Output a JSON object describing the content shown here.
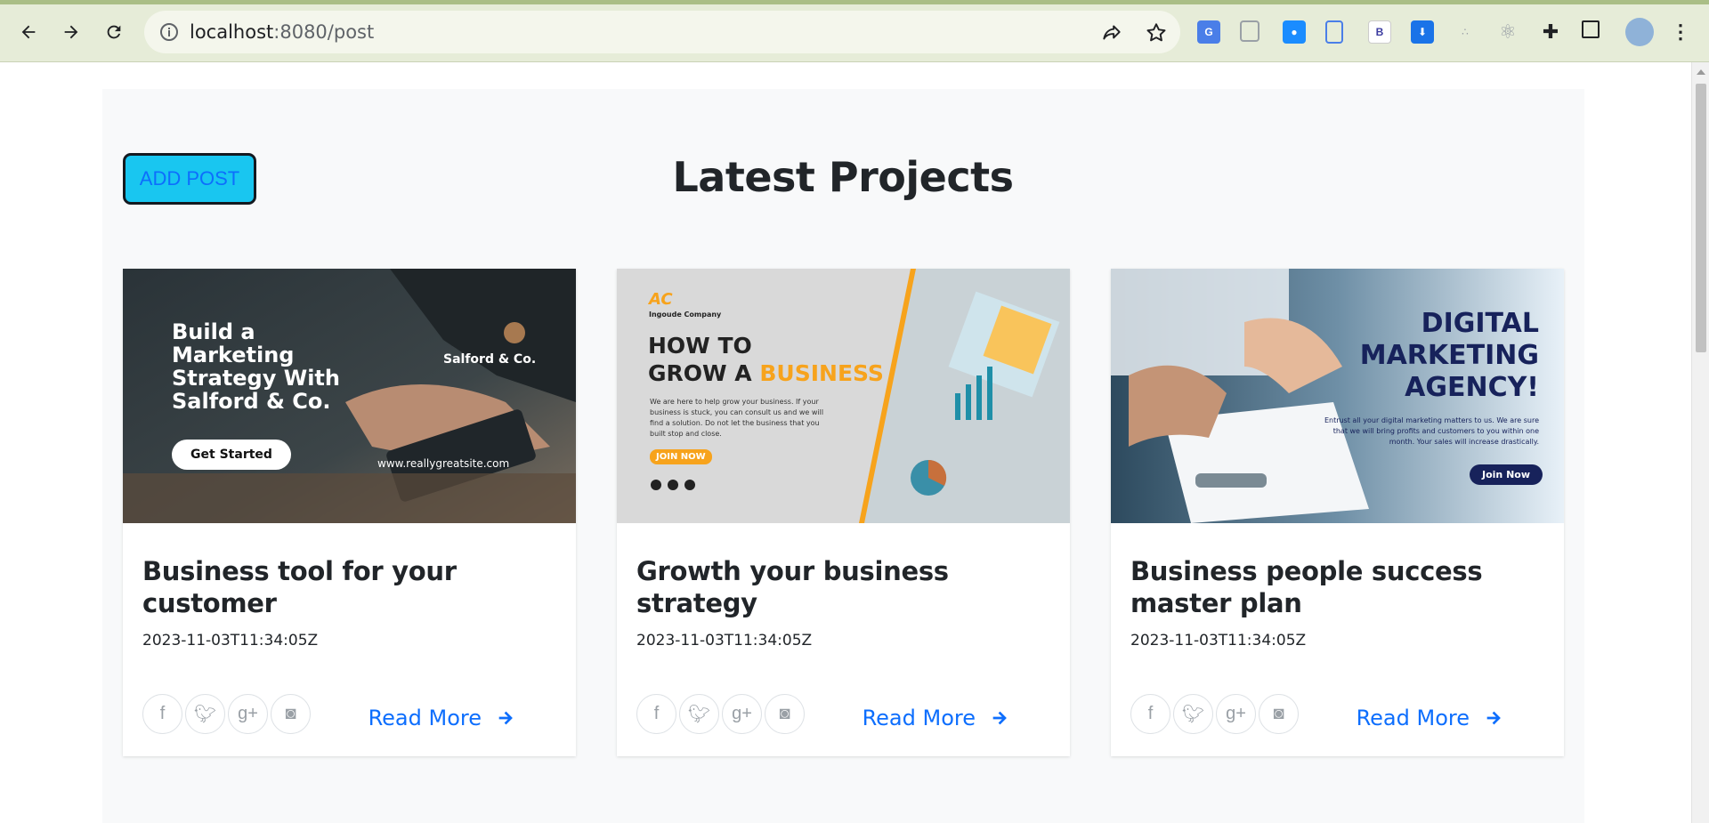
{
  "browser": {
    "url_host": "localhost",
    "url_path": ":8080/post"
  },
  "page": {
    "add_post_label": "ADD POST",
    "title": "Latest Projects"
  },
  "cards": [
    {
      "title": "Business tool for your customer",
      "date": "2023-11-03T11:34:05Z",
      "read_more": "Read More",
      "image": {
        "headline": "Build a Marketing Strategy With Salford & Co.",
        "brand": "Salford & Co.",
        "button": "Get Started",
        "website": "www.reallygreatsite.com"
      }
    },
    {
      "title": "Growth your business strategy",
      "date": "2023-11-03T11:34:05Z",
      "read_more": "Read More",
      "image": {
        "company": "Ingoude Company",
        "logo": "AC",
        "line1": "HOW TO",
        "line2a": "GROW A ",
        "line2b": "BUSINESS",
        "body": "We are here to help grow your business. If your business is stuck, you can consult us and we will find a solution. Do not let the business that you built stop and close.",
        "button": "JOIN NOW"
      }
    },
    {
      "title": "Business people success master plan",
      "date": "2023-11-03T11:34:05Z",
      "read_more": "Read More",
      "image": {
        "line1": "DIGITAL",
        "line2": "MARKETING",
        "line3": "AGENCY!",
        "body": "Entrust all your digital marketing matters to us. We are sure that we will bring profits and customers to you within one month. Your sales will increase drastically.",
        "button": "Join Now"
      }
    }
  ],
  "social_icons": [
    "facebook-icon",
    "twitter-icon",
    "google-plus-icon",
    "instagram-icon"
  ],
  "colors": {
    "accent": "#0d6efd",
    "add_post_bg": "#19c6f0",
    "section_bg": "#f8f9fa",
    "title": "#212529",
    "orange": "#f7a31c",
    "navy": "#17225b"
  }
}
